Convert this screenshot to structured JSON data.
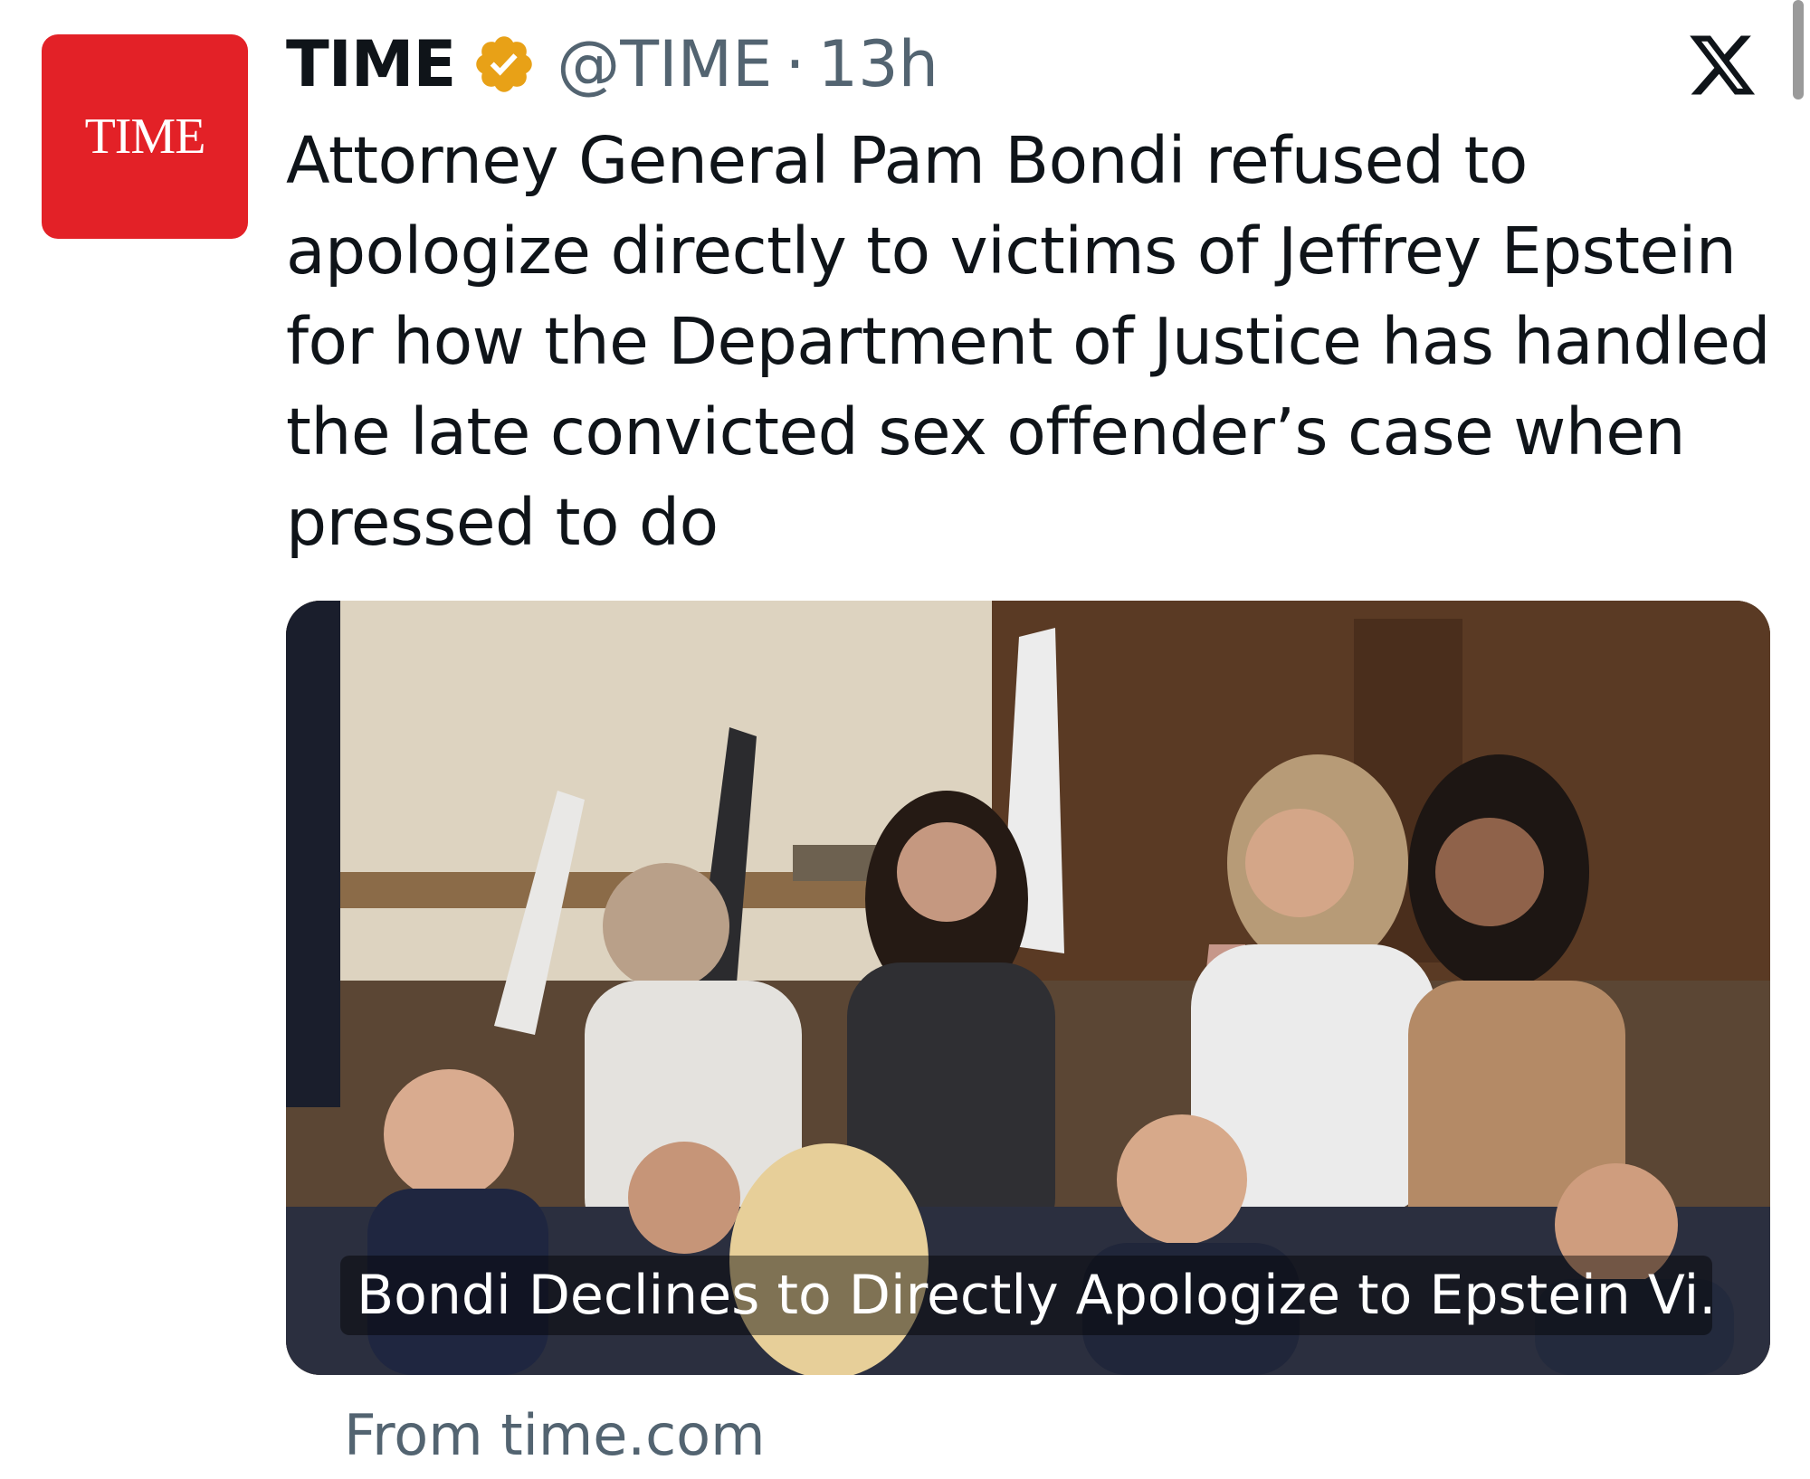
{
  "tweet": {
    "avatar_text": "TIME",
    "display_name": "TIME",
    "handle": "@TIME",
    "separator": "·",
    "timestamp": "13h",
    "verified_color": "#e8a117",
    "brand_color": "#e32127",
    "text": "Attorney General Pam Bondi refused to apologize directly to victims of Jeffrey Epstein for how the Department of Justice has handled the late convicted sex offender’s case when pressed to do"
  },
  "card": {
    "title": "Bondi Declines to Directly Apologize to Epstein Vi...",
    "source": "From time.com",
    "image_icon": "hearing-room-photo"
  },
  "icons": {
    "platform": "x-logo-icon",
    "badge": "verified-badge-icon"
  }
}
